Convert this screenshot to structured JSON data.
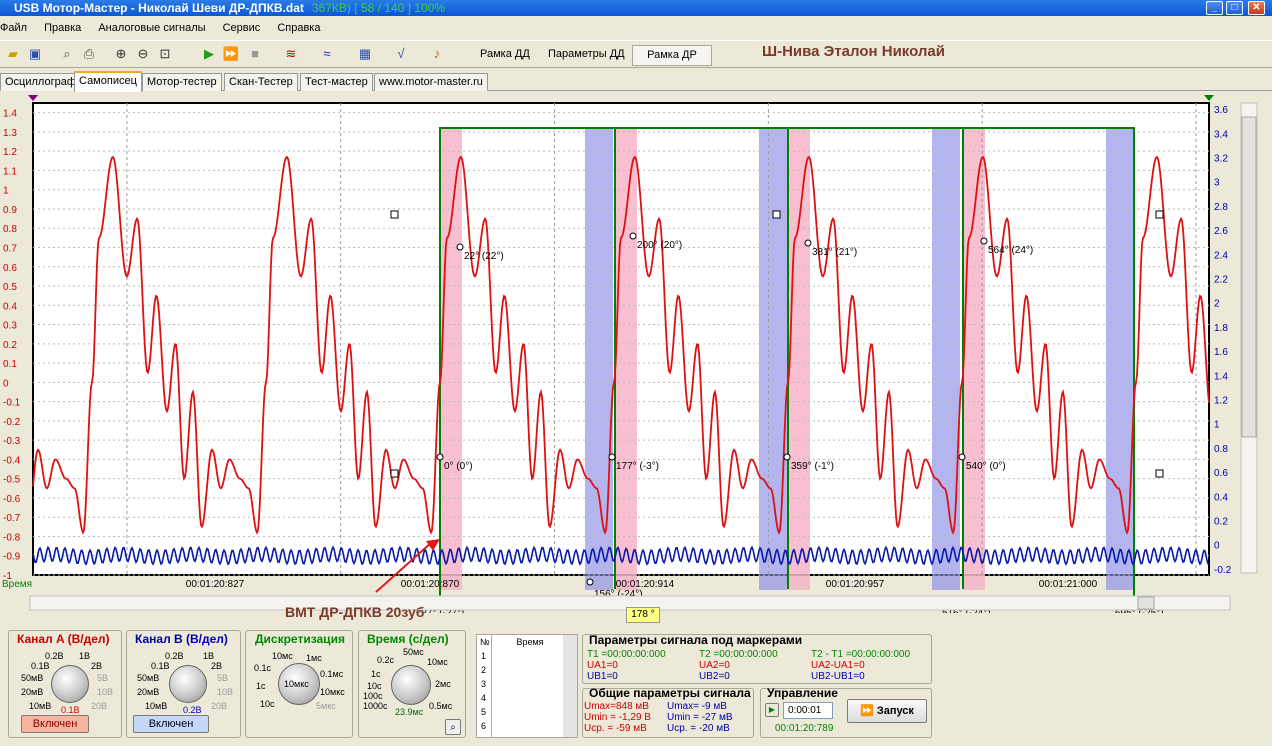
{
  "window": {
    "title": "USB Мотор-Мастер - Николай Шеви ДР-ДПКВ.dat",
    "status": "367КВ)  [ 58 / 140 ]  100%",
    "min": "_",
    "max": "□",
    "close": "✕"
  },
  "menu": [
    "Файл",
    "Правка",
    "Аналоговые сигналы",
    "Сервис",
    "Справка"
  ],
  "toolbar": {
    "frame_dd": "Рамка ДД",
    "params_dd": "Параметры ДД",
    "frame_dr": "Рамка ДР",
    "car": "Ш-Нива Эталон Николай",
    "icons": [
      "folder-open-icon",
      "save-icon",
      "print-preview-icon",
      "print-icon",
      "zoom-in-icon",
      "zoom-out-icon",
      "zoom-fit-icon",
      "play-icon",
      "fast-forward-icon",
      "stop-icon",
      "signal-filter-icon",
      "signal-smooth-icon",
      "calculator-icon",
      "sqrt-icon",
      "sound-icon"
    ]
  },
  "tabs": [
    "Осциллограф",
    "Самописец",
    "Мотор-тестер",
    "Скан-Тестер",
    "Тест-мастер",
    "www.motor-master.ru"
  ],
  "chart_data": {
    "type": "line",
    "y_left": {
      "ticks": [
        1.4,
        1.3,
        1.2,
        1.1,
        1,
        0.9,
        0.8,
        0.7,
        0.6,
        0.5,
        0.4,
        0.3,
        0.2,
        0.1,
        0,
        -0.1,
        -0.2,
        -0.3,
        -0.4,
        -0.5,
        -0.6,
        -0.7,
        -0.8,
        -0.9,
        -1
      ],
      "labels": [
        "1.4",
        "1.3",
        "1.2",
        "1.1",
        "1",
        "0.9",
        "0.8",
        "0.7",
        "0.6",
        "0.5",
        "0.4",
        "0.3",
        "0.2",
        "0.1",
        "0",
        "-0.1",
        "-0.2",
        "-0.3",
        "-0.4",
        "-0.5",
        "-0.6",
        "-0.7",
        "-0.8",
        "-0.9",
        "-1"
      ],
      "color": "#cc0000",
      "range": [
        -1.0,
        1.45
      ]
    },
    "y_right": {
      "ticks": [
        3.6,
        3.4,
        3.2,
        3,
        2.8,
        2.6,
        2.4,
        2.2,
        2,
        1.8,
        1.6,
        1.4,
        1.2,
        1,
        0.8,
        0.6,
        0.4,
        0.2,
        0,
        -0.2
      ],
      "labels": [
        "3.6",
        "3.4",
        "3.2",
        "3",
        "2.8",
        "2.6",
        "2.4",
        "2.2",
        "2",
        "1.8",
        "1.6",
        "1.4",
        "1.2",
        "1",
        "0.8",
        "0.6",
        "0.4",
        "0.2",
        "0",
        "-0.2"
      ],
      "color": "#0000aa",
      "range": [
        -0.25,
        3.65
      ]
    },
    "x_label": "Время",
    "x_ticks": [
      "00:01:20:827",
      "00:01:20:870",
      "00:01:20:914",
      "00:01:20:957",
      "00:01:21:000"
    ],
    "channel_a": {
      "name": "Канал A",
      "color": "#dd1111",
      "base": 0,
      "cycles": [
        {
          "phase": 0,
          "peaks": [
            [
              0.09,
              0.6
            ],
            [
              0.155,
              1.15
            ],
            [
              0.2,
              0.5
            ],
            [
              0.26,
              0.85
            ],
            [
              0.3,
              0.1
            ],
            [
              0.35,
              0.45
            ],
            [
              0.4,
              -0.3
            ],
            [
              0.46,
              0.3
            ],
            [
              0.52,
              -0.45
            ],
            [
              0.58,
              -0.1
            ],
            [
              0.64,
              -0.65
            ],
            [
              0.69,
              -0.5
            ],
            [
              0.74,
              -0.8
            ],
            [
              0.8,
              -0.35
            ],
            [
              0.86,
              -0.75
            ],
            [
              0.92,
              -0.5
            ],
            [
              0.97,
              -0.7
            ]
          ]
        },
        {
          "ratio": 1
        }
      ]
    },
    "channel_b": {
      "name": "Канал B",
      "color": "#0a1aa8",
      "level": -0.9,
      "amp": 0.045
    },
    "markers": [
      {
        "label": "22° (22°)"
      },
      {
        "label": "200° (20°)"
      },
      {
        "label": "381° (21°)"
      },
      {
        "label": "564° (24°)"
      },
      {
        "label": "0° (0°)"
      },
      {
        "label": "177° (-3°)"
      },
      {
        "label": "359° (-1°)"
      },
      {
        "label": "540° (0°)"
      },
      {
        "label": "-27° (-27°)"
      },
      {
        "label": "156° (-24°)"
      },
      {
        "label": "516° (-24°)"
      },
      {
        "label": "695° (-25°)"
      }
    ]
  },
  "annotation": {
    "text": "ВМТ ДР-ДПКВ 20зуб",
    "marker_value": "178 °"
  },
  "channel_a": {
    "title": "Канал A (В/дел)",
    "labels": [
      "0.2В",
      "1В",
      "0.1В",
      "2В",
      "50мВ",
      "5В",
      "20мВ",
      "10В",
      "10мВ",
      "20В",
      "0.1В"
    ],
    "button": "Включен"
  },
  "channel_b": {
    "title": "Канал B (В/дел)",
    "labels": [
      "0.2В",
      "1В",
      "0.1В",
      "2В",
      "50мВ",
      "5В",
      "20мВ",
      "10В",
      "10мВ",
      "20В",
      "0.2В"
    ],
    "button": "Включен"
  },
  "sampling": {
    "title": "Дискретизация",
    "labels": [
      "10мс",
      "1мс",
      "0.1с",
      "0.1мс",
      "1с",
      "10мкс",
      "10с",
      "5мкс"
    ],
    "center": "10мкс"
  },
  "timebase": {
    "title": "Время (с/дел)",
    "labels": [
      "50мс",
      "0.2с",
      "10мс",
      "1с",
      "2мс",
      "10с",
      "100с",
      "0.5мс",
      "1000с"
    ],
    "value": "23.9мс"
  },
  "table": {
    "col1": "№",
    "col2": "Время",
    "rows": [
      "1",
      "2",
      "3",
      "4",
      "5",
      "6"
    ]
  },
  "marker_params": {
    "title": "Параметры сигнала под маркерами",
    "t1": "T1 =00:00:00:000",
    "ua1": "UA1=0",
    "ub1": "UB1=0",
    "t2": "T2 =00:00:00:000",
    "ua2": "UA2=0",
    "ub2": "UB2=0",
    "dt": "T2 - T1 =00:00:00:000",
    "dua": "UA2-UA1=0",
    "dub": "UB2-UB1=0"
  },
  "common_params": {
    "title": "Общие параметры сигнала",
    "umax_a": "Umax=848 мВ",
    "umin_a": "Umin = -1,29 В",
    "ucp_a": "Ucp. = -59 мВ",
    "umax_b": "Umax= -9 мВ",
    "umin_b": "Umin = -27 мВ",
    "ucp_b": "Ucp. = -20 мВ"
  },
  "control": {
    "title": "Управление",
    "time": "0:00:01",
    "start": "Запуск",
    "clock": "00:01:20:789"
  },
  "colors": {
    "pink": "#f6b4c8",
    "blue_band": "#8c8ce6",
    "frame": "#008000"
  }
}
